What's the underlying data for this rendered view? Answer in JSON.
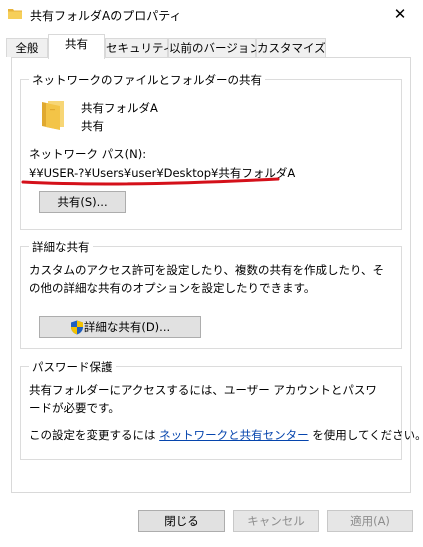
{
  "window": {
    "title": "共有フォルダAのプロパティ",
    "close_glyph": "✕"
  },
  "tabs": [
    {
      "label": "全般"
    },
    {
      "label": "共有"
    },
    {
      "label": "セキュリティ"
    },
    {
      "label": "以前のバージョン"
    },
    {
      "label": "カスタマイズ"
    }
  ],
  "network_share": {
    "group_title": "ネットワークのファイルとフォルダーの共有",
    "folder_name": "共有フォルダA",
    "folder_status": "共有",
    "path_label": "ネットワーク パス(N):",
    "path_value": "¥¥USER-?¥Users¥user¥Desktop¥共有フォルダA",
    "share_button": "共有(S)..."
  },
  "advanced_share": {
    "group_title": "詳細な共有",
    "description": "カスタムのアクセス許可を設定したり、複数の共有を作成したり、その他の詳細な共有のオプションを設定したりできます。",
    "button": "詳細な共有(D)..."
  },
  "password": {
    "group_title": "パスワード保護",
    "description": "共有フォルダーにアクセスするには、ユーザー アカウントとパスワードが必要です。",
    "change_prefix": "この設定を変更するには ",
    "change_link": "ネットワークと共有センター",
    "change_suffix": " を使用してください。"
  },
  "footer": {
    "close": "閉じる",
    "cancel": "キャンセル",
    "apply": "適用(A)"
  },
  "colors": {
    "link": "#0645ad",
    "annotation_underline": "#d4101a",
    "folder_yellow": "#f3c447"
  }
}
